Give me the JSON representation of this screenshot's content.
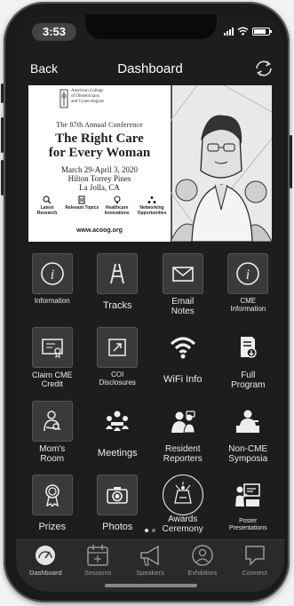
{
  "status": {
    "time": "3:53"
  },
  "nav": {
    "back_label": "Back",
    "title": "Dashboard"
  },
  "banner": {
    "org_line1": "American College",
    "org_line2": "of Obstetricians",
    "org_line3": "and Gynecologists",
    "conference_line": "The 87th Annual Conference",
    "title_line1": "The Right Care",
    "title_line2": "for Every Woman",
    "dates": "March 29-April 3, 2020",
    "venue": "Hilton Torrey Pines",
    "city": "La Jolla, CA",
    "features": [
      {
        "label": "Latest Research",
        "icon": "research-icon"
      },
      {
        "label": "Relevant Topics",
        "icon": "topics-icon"
      },
      {
        "label": "Healthcare Innovations",
        "icon": "innovation-icon"
      },
      {
        "label": "Networking Opportunities",
        "icon": "networking-icon"
      }
    ],
    "url": "www.acoog.org"
  },
  "tiles": [
    {
      "label": "Information",
      "icon": "info-icon"
    },
    {
      "label": "Tracks",
      "icon": "tracks-icon"
    },
    {
      "label": "Email Notes",
      "icon": "email-icon"
    },
    {
      "label": "CME Information",
      "icon": "cme-info-icon"
    },
    {
      "label": "Claim CME Credit",
      "icon": "certificate-icon"
    },
    {
      "label": "COI Disclosures",
      "icon": "disclosure-icon"
    },
    {
      "label": "WiFi Info",
      "icon": "wifi-icon"
    },
    {
      "label": "Full Program",
      "icon": "program-download-icon"
    },
    {
      "label": "Mom's Room",
      "icon": "mother-child-icon"
    },
    {
      "label": "Meetings",
      "icon": "meetings-icon"
    },
    {
      "label": "Resident Reporters",
      "icon": "reporters-icon"
    },
    {
      "label": "Non-CME Symposia",
      "icon": "symposia-icon"
    },
    {
      "label": "Prizes",
      "icon": "medal-icon"
    },
    {
      "label": "Photos",
      "icon": "camera-icon"
    },
    {
      "label": "Awards Ceremony",
      "icon": "awards-icon"
    },
    {
      "label": "Poster Presentations",
      "icon": "poster-icon"
    }
  ],
  "pager": {
    "pages": 2,
    "current": 1
  },
  "tabs": [
    {
      "label": "Dashboard",
      "icon": "gauge-icon",
      "active": true
    },
    {
      "label": "Sessions",
      "icon": "calendar-icon",
      "active": false
    },
    {
      "label": "Speakers",
      "icon": "megaphone-icon",
      "active": false
    },
    {
      "label": "Exhibitors",
      "icon": "exhibitor-icon",
      "active": false
    },
    {
      "label": "Connect",
      "icon": "chat-icon",
      "active": false
    }
  ],
  "colors": {
    "background": "#1d1d1d",
    "tile": "#3a3a3a",
    "text": "#eaeaea"
  }
}
